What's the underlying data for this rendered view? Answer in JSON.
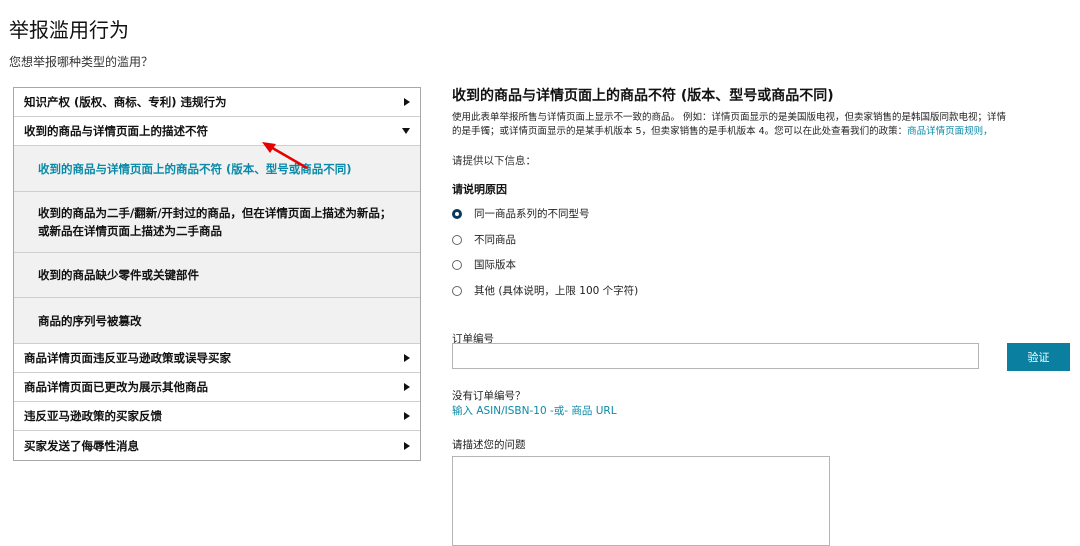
{
  "page": {
    "title": "举报滥用行为",
    "subtitle": "您想举报哪种类型的滥用？"
  },
  "menu": {
    "items": [
      {
        "label": "知识产权 (版权、商标、专利) 违规行为"
      },
      {
        "label": "收到的商品与详情页面上的描述不符"
      },
      {
        "label": "商品详情页面违反亚马逊政策或误导买家"
      },
      {
        "label": "商品详情页面已更改为展示其他商品"
      },
      {
        "label": "违反亚马逊政策的买家反馈"
      },
      {
        "label": "买家发送了侮辱性消息"
      }
    ],
    "subitems": [
      {
        "label": "收到的商品与详情页面上的商品不符 (版本、型号或商品不同)"
      },
      {
        "label_line1": "收到的商品为二手/翻新/开封过的商品，但在详情页面上描述为新品；",
        "label_line2": "或新品在详情页面上描述为二手商品"
      },
      {
        "label": "收到的商品缺少零件或关键部件"
      },
      {
        "label": "商品的序列号被篡改"
      }
    ]
  },
  "detail": {
    "title": "收到的商品与详情页面上的商品不符 (版本、型号或商品不同)",
    "desc_line1": "使用此表单举报所售与详情页面上显示不一致的商品。 例如：详情页面显示的是美国版电视，但卖家销售的是韩国版同款电视；详情",
    "desc_line2_text": "的是手镯；或详情页面显示的是某手机版本 5，但卖家销售的是手机版本 4。您可以在此处查看我们的政策：",
    "desc_line2_link": "商品详情页面规则，",
    "provide_info": "请提供以下信息：",
    "reason_title": "请说明原因",
    "reasons": [
      {
        "label": "同一商品系列的不同型号",
        "checked": true
      },
      {
        "label": "不同商品",
        "checked": false
      },
      {
        "label": "国际版本",
        "checked": false
      },
      {
        "label": "其他 (具体说明，上限 100 个字符)",
        "checked": false
      }
    ],
    "order_label": "订单编号",
    "order_value": "",
    "verify_label": "验证",
    "no_order": "没有订单编号？",
    "asin_link": "输入 ASIN/ISBN-10 -或- 商品 URL",
    "describe_label": "请描述您的问题"
  },
  "colors": {
    "accent": "#0a7fa0",
    "link": "#0a8aa8",
    "highlight": "#e60000"
  }
}
